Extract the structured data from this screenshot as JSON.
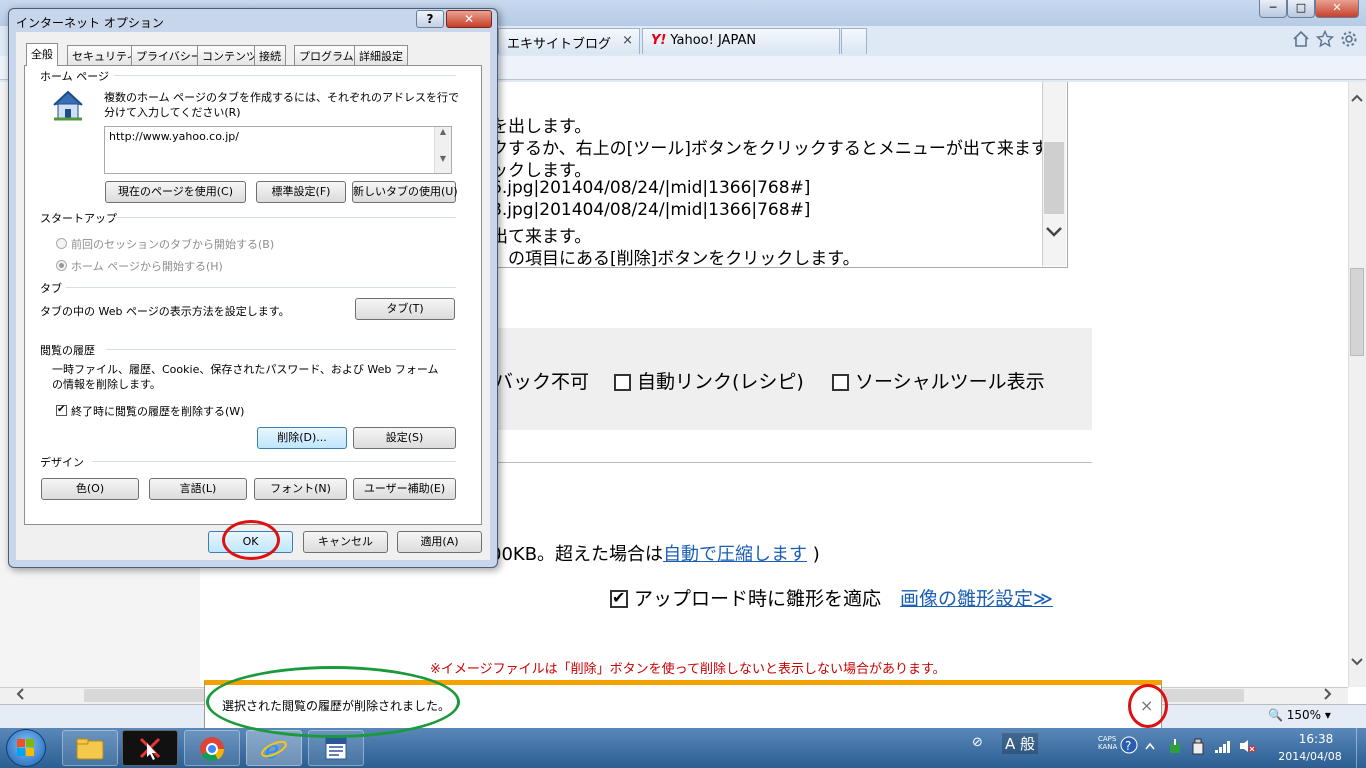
{
  "browser": {
    "tabs": [
      {
        "label": "エキサイトブログ",
        "close": "×"
      },
      {
        "label": "Yahoo! JAPAN",
        "brand": "Y!"
      }
    ],
    "window_controls": {
      "minimize": "─",
      "maximize": "□",
      "close": "✕"
    },
    "toolbar_icons": [
      "home-icon",
      "star-icon",
      "gear-icon"
    ]
  },
  "page": {
    "textbox_lines": [
      "を出します。",
      "クするか、右上の[ツール]ボタンをクリックするとメニューが出て来ます",
      "ックします。",
      "6.jpg|201404/08/24/|mid|1366|768#]",
      "8.jpg|201404/08/24/|mid|1366|768#]",
      "出て来ます。",
      "」の項目にある[削除]ボタンをクリックします。"
    ],
    "options": {
      "trackback": "バック不可",
      "autolink": "自動リンク(レシピ)",
      "social": "ソーシャルツール表示"
    },
    "size_note_prefix": "00KB。超えた場合は",
    "size_note_link": "自動で圧縮します",
    "size_note_suffix": " )",
    "upload_check_label": "アップロード時に雛形を適応",
    "shape_link": "画像の雛形設定≫",
    "warning": "※イメージファイルは「削除」ボタンを使って削除しないと表示しない場合があります。"
  },
  "notification": {
    "text": "選択された閲覧の履歴が削除されました。",
    "close": "×"
  },
  "status": {
    "zoom": "🔍 150%  ▾"
  },
  "dialog": {
    "title": "インターネット オプション",
    "help": "?",
    "close": "✕",
    "tabs": [
      "全般",
      "セキュリティ",
      "プライバシー",
      "コンテンツ",
      "接続",
      "プログラム",
      "詳細設定"
    ],
    "home": {
      "group": "ホーム ページ",
      "desc": "複数のホーム ページのタブを作成するには、それぞれのアドレスを行で分けて入力してください(R)",
      "url": "http://www.yahoo.co.jp/",
      "btn_current": "現在のページを使用(C)",
      "btn_default": "標準設定(F)",
      "btn_newtab": "新しいタブの使用(U)"
    },
    "startup": {
      "group": "スタートアップ",
      "opt_session": "前回のセッションのタブから開始する(B)",
      "opt_home": "ホーム ページから開始する(H)"
    },
    "tabs_group": {
      "group": "タブ",
      "desc": "タブの中の Web ページの表示方法を設定します。",
      "btn": "タブ(T)"
    },
    "history": {
      "group": "閲覧の履歴",
      "desc": "一時ファイル、履歴、Cookie、保存されたパスワード、および Web フォームの情報を削除します。",
      "check": "終了時に閲覧の履歴を削除する(W)",
      "btn_delete": "削除(D)...",
      "btn_settings": "設定(S)"
    },
    "design": {
      "group": "デザイン",
      "btn_color": "色(O)",
      "btn_lang": "言語(L)",
      "btn_font": "フォント(N)",
      "btn_access": "ユーザー補助(E)"
    },
    "btn_ok": "OK",
    "btn_cancel": "キャンセル",
    "btn_apply": "適用(A)"
  },
  "taskbar": {
    "tray_text": "⊘",
    "ime": "A 般",
    "caps": "CAPS\nKANA",
    "time": "16:38",
    "date": "2014/04/08"
  },
  "colors": {
    "annotation_red": "#dd1111",
    "annotation_green": "#1a9a3a",
    "notification_accent": "#f3a200",
    "link": "#1a5fb4",
    "warning": "#cc0000"
  }
}
